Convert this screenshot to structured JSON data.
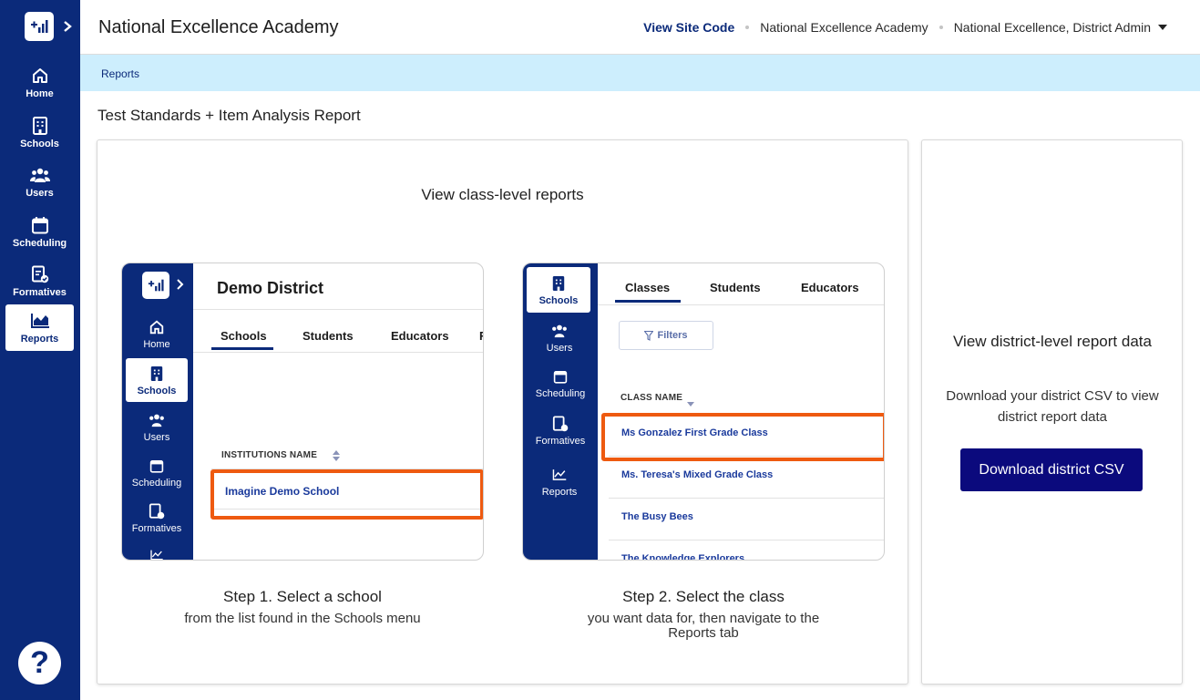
{
  "sidebar": {
    "items": [
      {
        "label": "Home",
        "icon": "home-icon"
      },
      {
        "label": "Schools",
        "icon": "building-icon"
      },
      {
        "label": "Users",
        "icon": "users-icon"
      },
      {
        "label": "Scheduling",
        "icon": "calendar-icon"
      },
      {
        "label": "Formatives",
        "icon": "formatives-icon"
      },
      {
        "label": "Reports",
        "icon": "chart-icon",
        "active": true
      }
    ],
    "help_label": "?"
  },
  "header": {
    "title": "National Excellence Academy",
    "view_site_code": "View Site Code",
    "org_name": "National Excellence Academy",
    "user_menu": "National Excellence, District Admin"
  },
  "breadcrumb": {
    "label": "Reports"
  },
  "page": {
    "title": "Test Standards + Item Analysis Report"
  },
  "class_reports": {
    "heading": "View class-level reports",
    "step1": {
      "title": "Step 1. Select a school",
      "subtitle": "from the list found in the Schools menu",
      "mock": {
        "district_name": "Demo District",
        "nav": [
          "Home",
          "Schools",
          "Users",
          "Scheduling",
          "Formatives"
        ],
        "tabs": [
          "Schools",
          "Students",
          "Educators",
          "R"
        ],
        "column_header": "INSTITUTIONS NAME",
        "rows": [
          "Imagine Demo School"
        ]
      }
    },
    "step2": {
      "title": "Step 2. Select the class",
      "subtitle_line1": "you want data for, then navigate to the",
      "subtitle_line2": "Reports tab",
      "mock": {
        "nav": [
          "Schools",
          "Users",
          "Scheduling",
          "Formatives",
          "Reports"
        ],
        "tabs": [
          "Classes",
          "Students",
          "Educators"
        ],
        "filters_label": "Filters",
        "column_header": "CLASS NAME",
        "rows": [
          "Ms Gonzalez First Grade Class",
          "Ms. Teresa's Mixed Grade Class",
          "The Busy Bees",
          "The Knowledge Explorers"
        ]
      }
    }
  },
  "district_reports": {
    "heading": "View district-level report data",
    "description": "Download your district CSV to view district report data",
    "button_label": "Download district CSV"
  },
  "colors": {
    "navy": "#0b2a7a",
    "highlight": "#ee5a10",
    "crumb_bg": "#cdeefd",
    "button": "#0b0a7d"
  }
}
